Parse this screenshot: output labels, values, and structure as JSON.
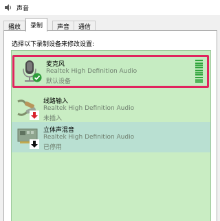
{
  "window": {
    "title": "声音"
  },
  "tabs": [
    {
      "label": "播放"
    },
    {
      "label": "录制"
    },
    {
      "label": "声音"
    },
    {
      "label": "通信"
    }
  ],
  "instruction": "选择以下录制设备来修改设置:",
  "devices": [
    {
      "name": "麦克风",
      "driver": "Realtek High Definition Audio",
      "status": "默认设备",
      "state_icon": "green-check-icon",
      "level_bars": 14
    },
    {
      "name": "线路输入",
      "driver": "Realtek High Definition Audio",
      "status": "未插入",
      "state_icon": "red-down-arrow-icon"
    },
    {
      "name": "立体声混音",
      "driver": "Realtek High Definition Audio",
      "status": "已停用",
      "state_icon": "black-down-arrow-icon"
    }
  ],
  "colors": {
    "list_bg": "#c9edc3",
    "highlight_border": "#e0245e",
    "level_green": "#2ea43a",
    "selected_row": "#b9e0d2"
  }
}
